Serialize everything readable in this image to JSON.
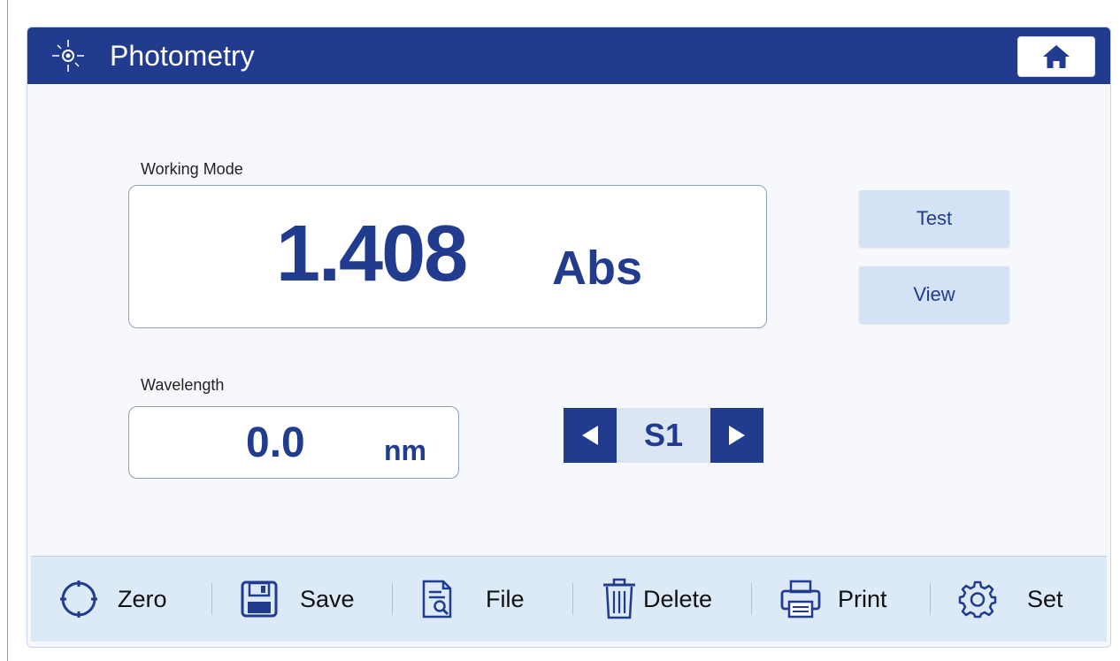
{
  "header": {
    "title": "Photometry",
    "title_icon": "light-burst-icon",
    "home_icon": "home-icon"
  },
  "working_mode": {
    "label": "Working Mode",
    "value": "1.408",
    "unit": "Abs"
  },
  "wavelength": {
    "label": "Wavelength",
    "value": "0.0",
    "unit": "nm"
  },
  "actions": {
    "test_label": "Test",
    "view_label": "View"
  },
  "sample_selector": {
    "value": "S1"
  },
  "toolbar": {
    "items": [
      {
        "label": "Zero",
        "icon": "zero-crosshair-icon"
      },
      {
        "label": "Save",
        "icon": "floppy-disk-icon"
      },
      {
        "label": "File",
        "icon": "file-search-icon"
      },
      {
        "label": "Delete",
        "icon": "trash-icon"
      },
      {
        "label": "Print",
        "icon": "printer-icon"
      },
      {
        "label": "Set",
        "icon": "gear-icon"
      }
    ]
  },
  "colors": {
    "primary": "#213b8e",
    "button_bg": "#d3e3f5",
    "toolbar_bg": "#dce9f6",
    "panel_bg": "#f6f8fb"
  }
}
